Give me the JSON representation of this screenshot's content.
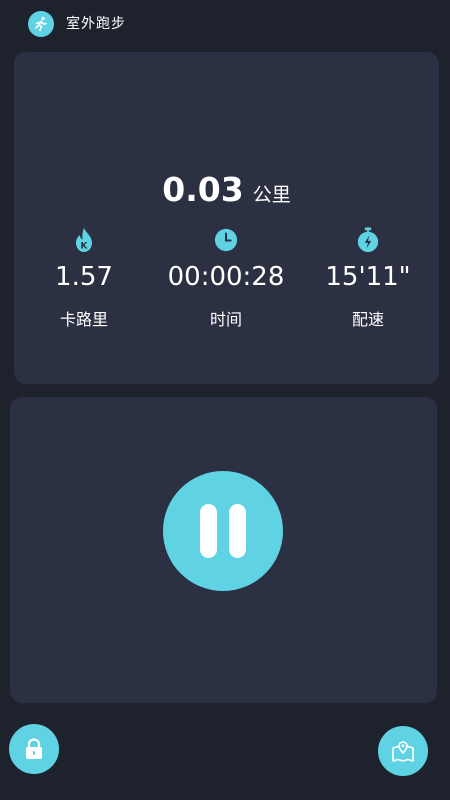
{
  "header": {
    "title": "室外跑步",
    "icon": "runner-icon"
  },
  "distance": {
    "value": "0.03",
    "unit": "公里"
  },
  "metrics": [
    {
      "icon": "fire-k-icon",
      "value": "1.57",
      "label": "卡路里"
    },
    {
      "icon": "clock-icon",
      "value": "00:00:28",
      "label": "时间"
    },
    {
      "icon": "stopwatch-bolt-icon",
      "value": "15'11\"",
      "label": "配速"
    }
  ],
  "controls": {
    "pause_icon": "pause-icon",
    "lock_icon": "lock-icon",
    "map_icon": "map-location-icon"
  },
  "colors": {
    "background": "#1e222d",
    "card": "#2b3142",
    "accent": "#5fd3e3",
    "text": "#ffffff"
  }
}
